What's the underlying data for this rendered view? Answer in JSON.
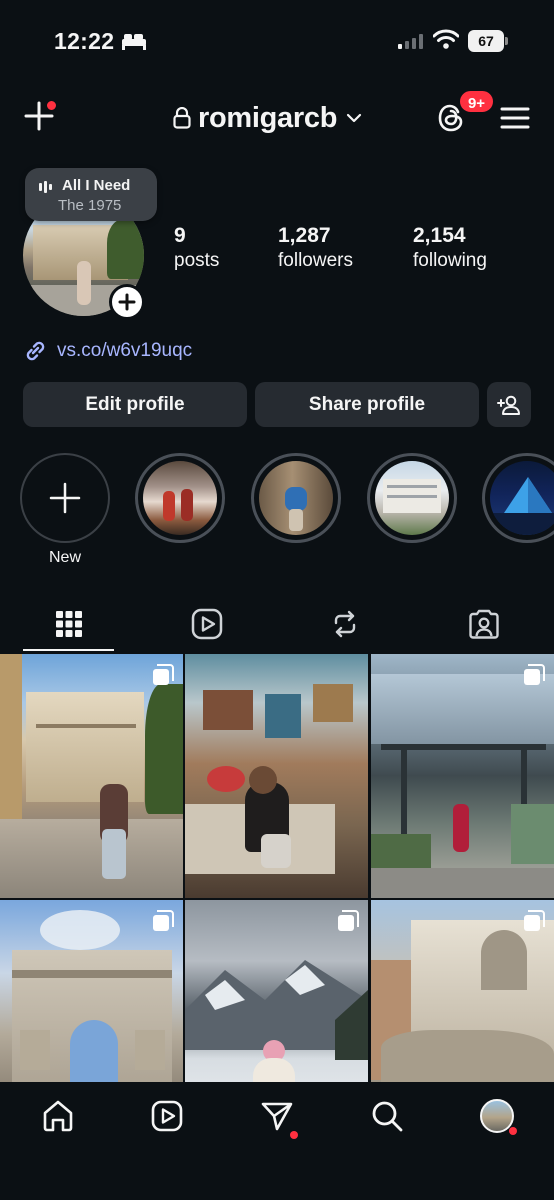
{
  "status_bar": {
    "time": "12:22",
    "battery": "67",
    "focus_icon": "bed-icon",
    "signal_icon": "cellular-signal-icon",
    "wifi_icon": "wifi-icon"
  },
  "header": {
    "username": "romigarcb",
    "threads_badge": "9+",
    "icons": [
      "plus-icon",
      "lock-icon",
      "chevron-down-icon",
      "threads-icon",
      "hamburger-menu-icon"
    ]
  },
  "profile": {
    "music": {
      "title": "All I Need",
      "artist": "The 1975"
    },
    "stats": {
      "posts": {
        "value": "9",
        "label": "posts"
      },
      "followers": {
        "value": "1,287",
        "label": "followers"
      },
      "following": {
        "value": "2,154",
        "label": "following"
      }
    },
    "link": "vs.co/w6v19uqc",
    "buttons": {
      "edit": "Edit profile",
      "share": "Share profile"
    }
  },
  "highlights": {
    "new_label": "New",
    "count": 4
  },
  "tabs": [
    "grid-icon",
    "reels-icon",
    "reposts-icon",
    "tagged-icon"
  ],
  "bottom_nav": [
    "home-icon",
    "reels-icon",
    "send-icon",
    "search-icon",
    "profile-avatar"
  ],
  "colors": {
    "background": "#0b1014",
    "button": "#262b31",
    "notification": "#ff3040",
    "link": "#a8b6ff"
  }
}
